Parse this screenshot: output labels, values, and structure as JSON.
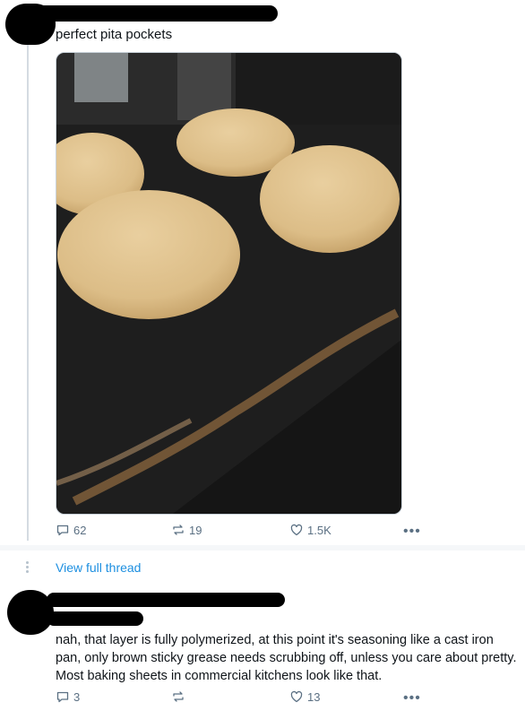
{
  "post": {
    "text": "perfect pita pockets",
    "image_alt": "pita breads on baking sheet",
    "stats": {
      "replies": "62",
      "reposts": "19",
      "likes": "1.5K"
    }
  },
  "thread": {
    "view_full_thread": "View full thread"
  },
  "reply": {
    "text": "nah, that layer is fully polymerized, at this point it's seasoning like a cast iron pan, only brown sticky grease needs scrubbing off, unless you care about pretty. Most baking sheets in commercial kitchens look like that.",
    "stats": {
      "replies": "3",
      "reposts": "",
      "likes": "13"
    }
  },
  "icons": {
    "reply": "speech-bubble-icon",
    "repost": "repost-arrows-icon",
    "like": "heart-icon",
    "more": "ellipsis-icon"
  },
  "colors": {
    "link": "#1d8fe0",
    "muted": "#5b7083",
    "thread_line": "#d4dbe2"
  }
}
